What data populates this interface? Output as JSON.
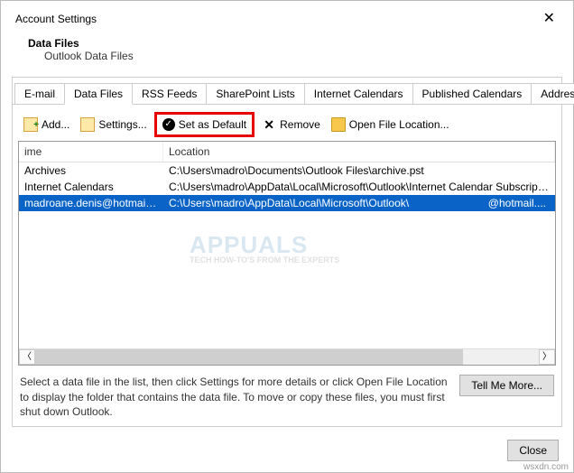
{
  "window": {
    "title": "Account Settings"
  },
  "header": {
    "title": "Data Files",
    "subtitle": "Outlook Data Files"
  },
  "tabs": {
    "items": [
      {
        "label": "E-mail"
      },
      {
        "label": "Data Files"
      },
      {
        "label": "RSS Feeds"
      },
      {
        "label": "SharePoint Lists"
      },
      {
        "label": "Internet Calendars"
      },
      {
        "label": "Published Calendars"
      },
      {
        "label": "Address Books"
      }
    ],
    "active_index": 1
  },
  "toolbar": {
    "add": "Add...",
    "settings": "Settings...",
    "set_default": "Set as Default",
    "remove": "Remove",
    "open_location": "Open File Location..."
  },
  "table": {
    "columns": {
      "name": "ime",
      "location": "Location"
    },
    "rows": [
      {
        "name": "Archives",
        "location": "C:\\Users\\madro\\Documents\\Outlook Files\\archive.pst"
      },
      {
        "name": "Internet Calendars",
        "location": "C:\\Users\\madro\\AppData\\Local\\Microsoft\\Outlook\\Internet Calendar Subscripti..."
      },
      {
        "name": "madroane.denis@hotmail.c...",
        "location": "C:\\Users\\madro\\AppData\\Local\\Microsoft\\Outlook\\",
        "extra": "@hotmail...."
      }
    ],
    "selected_index": 2
  },
  "help": {
    "text": "Select a data file in the list, then click Settings for more details or click Open File Location to display the folder that contains the data file. To move or copy these files, you must first shut down Outlook.",
    "tell_me_more": "Tell Me More..."
  },
  "footer": {
    "close": "Close"
  },
  "credit": "wsxdn.com"
}
